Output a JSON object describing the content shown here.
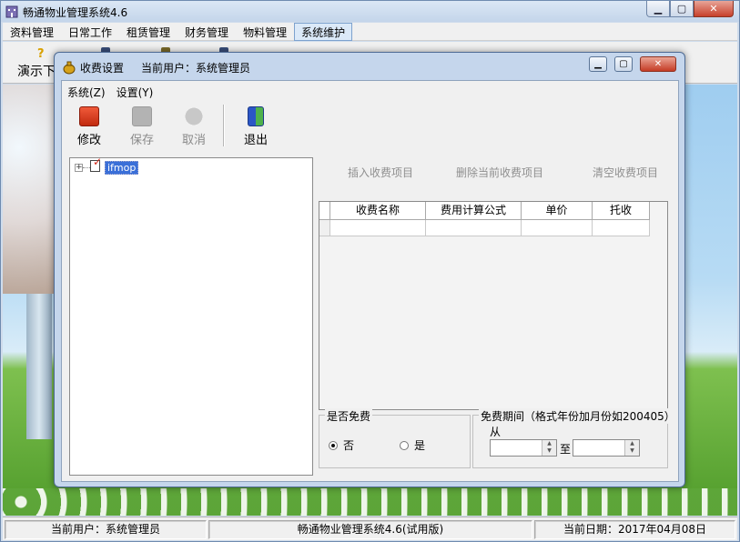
{
  "window": {
    "title": "畅通物业管理系统4.6",
    "controls": {
      "minimize": "▁",
      "maximize": "▢",
      "close": "✕"
    }
  },
  "menubar": {
    "items": [
      {
        "label": "资料管理",
        "active": false
      },
      {
        "label": "日常工作",
        "active": false
      },
      {
        "label": "租赁管理",
        "active": false
      },
      {
        "label": "财务管理",
        "active": false
      },
      {
        "label": "物料管理",
        "active": false
      },
      {
        "label": "系统维护",
        "active": true
      }
    ]
  },
  "main_toolbar": {
    "help_icon": "?",
    "demo_label": "演示下"
  },
  "dialog": {
    "title": "收费设置",
    "current_user": "当前用户：系统管理员",
    "controls": {
      "minimize": "▁",
      "maximize": "▢",
      "close": "✕"
    },
    "menu": [
      {
        "label": "系统(Z)"
      },
      {
        "label": "设置(Y)"
      }
    ],
    "toolbar": {
      "edit": "修改",
      "save": "保存",
      "cancel": "取消",
      "exit": "退出"
    },
    "tree": {
      "expander": "+",
      "root_label": "ifmop"
    },
    "actions": {
      "insert": "插入收费项目",
      "delete": "删除当前收费项目",
      "clear": "清空收费项目"
    },
    "grid": {
      "columns": [
        "收费名称",
        "费用计算公式",
        "单价",
        "托收"
      ],
      "rows": [
        [
          "",
          "",
          "",
          ""
        ]
      ]
    },
    "free_group": {
      "title": "是否免费",
      "options": [
        {
          "label": "否",
          "checked": true
        },
        {
          "label": "是",
          "checked": false
        }
      ]
    },
    "period_group": {
      "title": "免费期间（格式年份加月份如200405）",
      "from_label": "从",
      "to_label": "至",
      "from_value": "",
      "to_value": ""
    }
  },
  "statusbar": {
    "user": "当前用户：系统管理员",
    "version": "畅通物业管理系统4.6(试用版)",
    "date": "当前日期：2017年04月08日"
  },
  "colors": {
    "window_frame": "#c5d6ec",
    "selection": "#3a6fd8",
    "close_button": "#c53b25",
    "disabled_text": "#8f8f8f"
  }
}
